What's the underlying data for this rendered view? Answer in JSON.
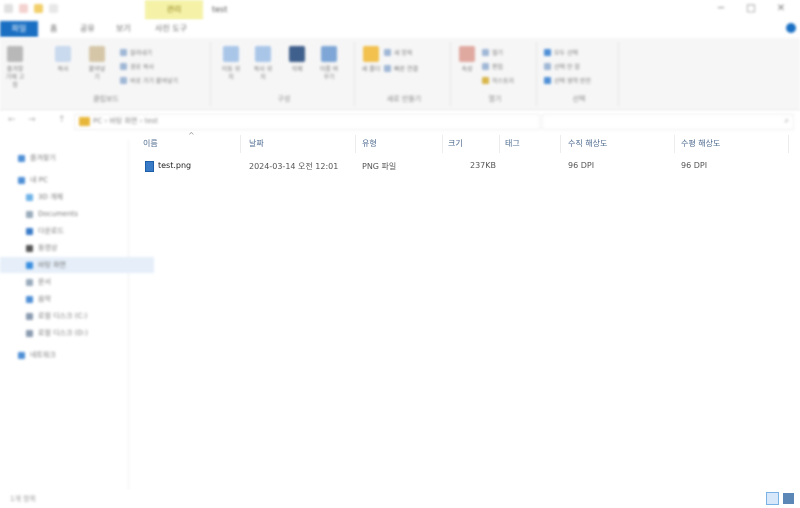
{
  "titlebar": {
    "context_tab": "관리",
    "window_title": "test",
    "minimize": "─",
    "maximize": "□",
    "close": "✕"
  },
  "ribbon_tabs": {
    "file": "파일",
    "home": "홈",
    "share": "공유",
    "view": "보기",
    "picture_tools": "사진 도구"
  },
  "ribbon": {
    "groups": [
      "클립보드",
      "구성",
      "새로 만들기",
      "열기",
      "선택"
    ],
    "clipboard": {
      "pin": "즐겨찾기에 고정",
      "copy": "복사",
      "paste": "붙여넣기",
      "cut": "잘라내기",
      "copy_path": "경로 복사",
      "paste_shortcut": "바로 가기 붙여넣기"
    },
    "organize": {
      "move_to": "이동 위치",
      "copy_to": "복사 위치",
      "delete": "삭제",
      "rename": "이름 바꾸기"
    },
    "new": {
      "new_folder": "새 폴더",
      "new_item": "새 항목",
      "easy_access": "빠른 연결"
    },
    "open": {
      "properties": "속성",
      "open": "열기",
      "edit": "편집",
      "history": "히스토리"
    },
    "select": {
      "select_all": "모두 선택",
      "select_none": "선택 안 함",
      "invert": "선택 영역 반전"
    }
  },
  "address": {
    "path": "PC  ›  바탕 화면  ›  test",
    "back": "←",
    "forward": "→",
    "up": "↑"
  },
  "nav": {
    "items": [
      "즐겨찾기",
      "내 PC",
      "3D 개체",
      "Documents",
      "다운로드",
      "동영상",
      "바탕 화면",
      "문서",
      "음악",
      "로컬 디스크 (C:)",
      "로컬 디스크 (D:)",
      "네트워크"
    ]
  },
  "columns": {
    "name": "이름",
    "date": "날짜",
    "type": "유형",
    "size": "크기",
    "tags": "태그",
    "vres": "수직 해상도",
    "hres": "수평 해상도"
  },
  "files": [
    {
      "name": "test.png",
      "date": "2024-03-14 오전 12:01",
      "type": "PNG 파일",
      "size": "237KB",
      "tags": "",
      "vres": "96 DPI",
      "hres": "96 DPI"
    }
  ],
  "status": {
    "count": "1개 항목"
  },
  "colors": {
    "accent": "#1a6fc3",
    "context_tab": "#f5f2a8",
    "selection": "#e5eef9"
  }
}
